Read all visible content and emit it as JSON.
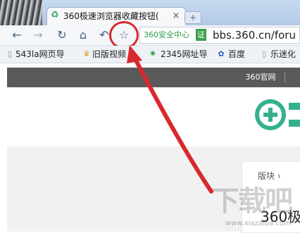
{
  "browser": {
    "tab": {
      "title": "360极速浏览器收藏按钮(",
      "close_label": "×"
    },
    "new_tab_label": "+",
    "toolbar": {
      "back_icon": "←",
      "forward_icon": "→",
      "refresh_icon": "↻",
      "home_icon": "⌂",
      "undo_icon": "↶",
      "star_icon": "☆"
    },
    "address_bar": {
      "security_label": "360安全中心",
      "security_badge": "证",
      "url": "bbs.360.cn/foru"
    },
    "bookmarks": [
      {
        "icon": "page-icon",
        "label": "543la网页导"
      },
      {
        "icon": "cup-icon",
        "label": "旧版视频"
      },
      {
        "icon": "2345-icon",
        "label": "2345网址导"
      },
      {
        "icon": "baidu-paw-icon",
        "label": "百度"
      },
      {
        "icon": "page-icon",
        "label": "乐迷化"
      }
    ]
  },
  "page": {
    "nav_link": "360官网",
    "breadcrumb": "版块 ›",
    "heading": "360极"
  },
  "annotation": {
    "color": "#d9282d"
  },
  "watermark": {
    "text": "下载吧",
    "url": "www.xiazaiba.com"
  },
  "colors": {
    "dark_bar": "#5a5a5a",
    "logo_green": "#35b08f",
    "accent_blue": "#3f5f86"
  }
}
